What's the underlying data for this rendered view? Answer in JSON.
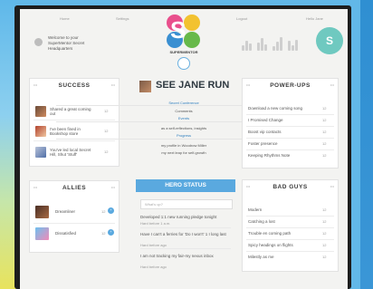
{
  "header": {
    "left_note": "Welcome to your SuperMentor Secret Headquarters",
    "top_left": "Home",
    "top_center": "Settings",
    "top_right": "Logout",
    "top_far_right": "Hello Jane",
    "logo_text": "SUPERMENTOR",
    "profile_badge": "S"
  },
  "sections": {
    "success": {
      "title": "SUCCESS",
      "items": [
        {
          "text": "Shared a great coming out",
          "meta": "12"
        },
        {
          "text": "I've been fined in Bookshop store",
          "meta": "12"
        },
        {
          "text": "You've led local Secret Hill, Shut 'Stuff'",
          "meta": "12"
        }
      ]
    },
    "center": {
      "title": "SEE JANE RUN",
      "links": [
        "Secret Conference",
        "Comments",
        "Events",
        "as a self-reflections, insights",
        "Progress",
        "my profile in Woodrow Miller",
        "my next leap for self-growth"
      ]
    },
    "powerups": {
      "title": "POWER-UPS",
      "items": [
        {
          "text": "Download a new coming song",
          "meta": "12"
        },
        {
          "text": "I Promised Change",
          "meta": "12"
        },
        {
          "text": "Boost vip contacts",
          "meta": "12"
        },
        {
          "text": "Foster presence",
          "meta": "12"
        },
        {
          "text": "Keeping Rhythms Note",
          "meta": "12"
        }
      ]
    },
    "allies": {
      "title": "ALLIES",
      "items": [
        {
          "text": "Dreamliner",
          "meta": "12"
        },
        {
          "text": "Dissatisfied",
          "meta": "12"
        }
      ]
    },
    "herostatus": {
      "title": "HERO STATUS",
      "input_placeholder": "What's up?",
      "posts": [
        {
          "text": "Developed 1:1 new running pledge tonight",
          "time": "Hard before 1 a.m."
        },
        {
          "text": "Have I can't a ferries for 'Do I won't' 1 I long last",
          "time": "Hard before ago"
        },
        {
          "text": "I am not tracking my fair-my nexus inbox",
          "time": "Hard before ago"
        }
      ]
    },
    "badguys": {
      "title": "BAD GUYS",
      "items": [
        {
          "text": "Modern",
          "meta": "12"
        },
        {
          "text": "Catching a lost",
          "meta": "12"
        },
        {
          "text": "Trouble en coming path",
          "meta": "12"
        },
        {
          "text": "Spicy headings on flights",
          "meta": "12"
        },
        {
          "text": "Milestly as me",
          "meta": "12"
        }
      ]
    }
  },
  "colors": {
    "accent": "#5aa9df",
    "logo_pink": "#e94f8c",
    "logo_yellow": "#f2c230",
    "logo_blue": "#3a8fd1",
    "logo_green": "#67b94a"
  },
  "icons": {
    "home": "home-icon",
    "settings": "settings-icon",
    "logout": "logout-icon",
    "profile": "profile-badge-icon"
  }
}
